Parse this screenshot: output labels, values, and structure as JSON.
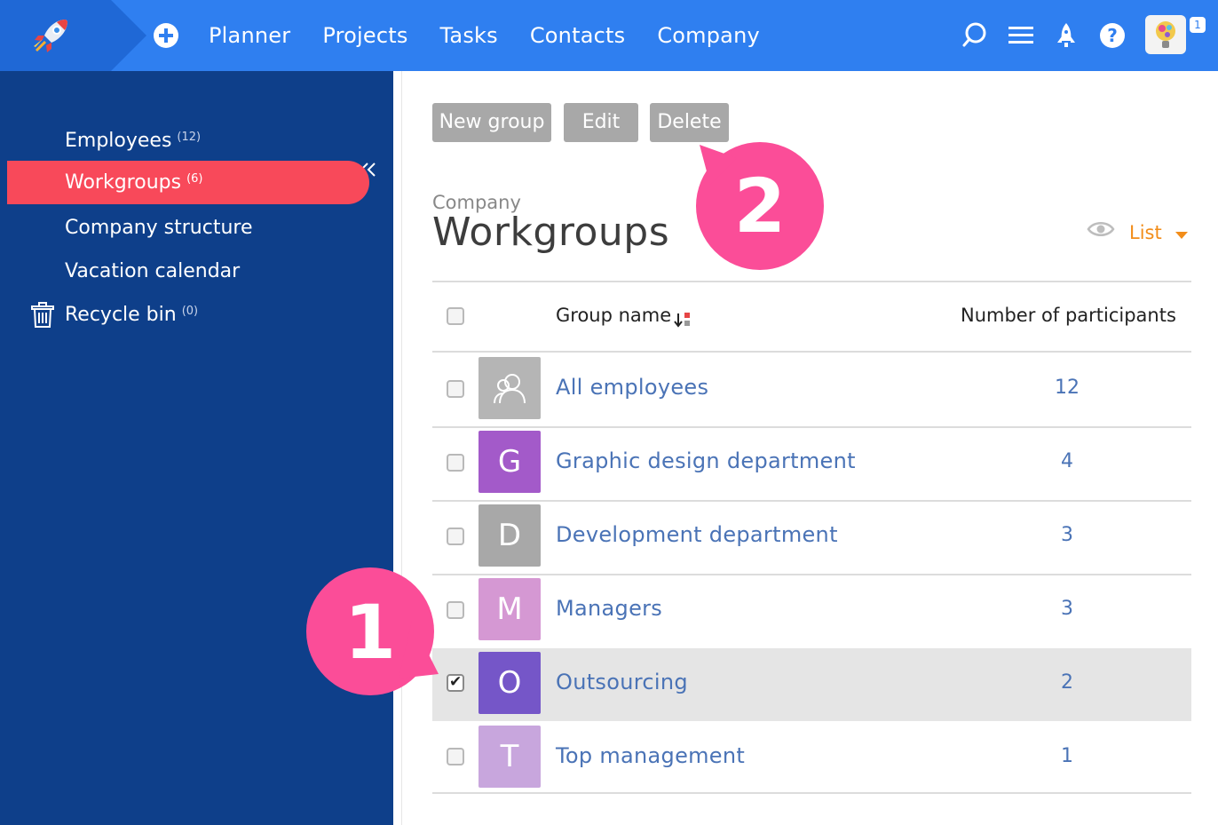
{
  "nav": {
    "items": [
      "Planner",
      "Projects",
      "Tasks",
      "Contacts",
      "Company"
    ],
    "notification_count": "1"
  },
  "icons": {
    "logo": "rocket-logo-icon",
    "add": "plus-circle-icon",
    "search": "search-icon",
    "menu": "hamburger-menu-icon",
    "launch": "rocket-icon",
    "help": "help-icon",
    "collapse": "double-chevron-left-icon",
    "trash": "trash-icon",
    "eye": "eye-icon",
    "sort": "sort-icon",
    "all_employees": "users-icon"
  },
  "sidebar": {
    "items": [
      {
        "label": "Employees",
        "count": "(12)"
      },
      {
        "label": "Workgroups",
        "count": "(6)"
      },
      {
        "label": "Company structure",
        "count": ""
      },
      {
        "label": "Vacation calendar",
        "count": ""
      },
      {
        "label": "Recycle bin",
        "count": "(0)"
      }
    ]
  },
  "toolbar": {
    "new_group": "New group",
    "edit": "Edit",
    "delete": "Delete"
  },
  "page": {
    "breadcrumb": "Company",
    "title": "Workgroups",
    "view_mode": "List"
  },
  "table": {
    "columns": [
      "Group name",
      "Number of participants"
    ],
    "rows": [
      {
        "letter": "",
        "name": "All employees",
        "count": "12",
        "color": "#b5b5b5",
        "checked": false
      },
      {
        "letter": "G",
        "name": "Graphic design department",
        "count": "4",
        "color": "#a35ac9",
        "checked": false
      },
      {
        "letter": "D",
        "name": "Development department",
        "count": "3",
        "color": "#a8a8a8",
        "checked": false
      },
      {
        "letter": "M",
        "name": "Managers",
        "count": "3",
        "color": "#d598d3",
        "checked": false
      },
      {
        "letter": "O",
        "name": "Outsourcing",
        "count": "2",
        "color": "#7556c8",
        "checked": true
      },
      {
        "letter": "T",
        "name": "Top management",
        "count": "1",
        "color": "#c8a6dd",
        "checked": false
      }
    ]
  },
  "callouts": [
    "1",
    "2"
  ],
  "colors": {
    "topbar": "#2f7ff0",
    "sidebar": "#0e3f8a",
    "active_item": "#f8495a",
    "callout": "#fb4d98",
    "link": "#4a73b6",
    "accent": "#f28d1a"
  }
}
